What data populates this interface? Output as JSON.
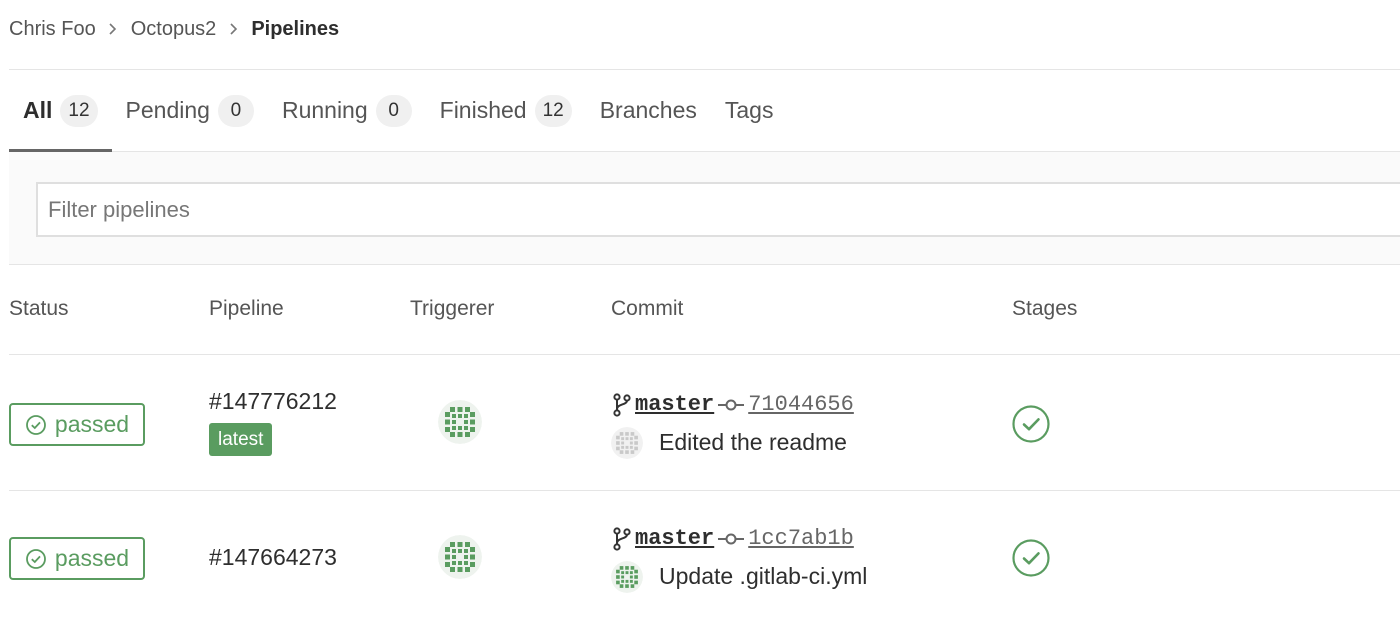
{
  "breadcrumb": {
    "items": [
      "Chris Foo",
      "Octopus2"
    ],
    "current": "Pipelines"
  },
  "tabs": [
    {
      "label": "All",
      "count": "12"
    },
    {
      "label": "Pending",
      "count": "0"
    },
    {
      "label": "Running",
      "count": "0"
    },
    {
      "label": "Finished",
      "count": "12"
    },
    {
      "label": "Branches"
    },
    {
      "label": "Tags"
    }
  ],
  "filter": {
    "placeholder": "Filter pipelines",
    "value": ""
  },
  "columns": [
    "Status",
    "Pipeline",
    "Triggerer",
    "Commit",
    "Stages"
  ],
  "rows": [
    {
      "status": "passed",
      "pipeline_id": "#147776212",
      "tag": "latest",
      "branch": "master",
      "sha": "71044656",
      "commit_title": "Edited the readme"
    },
    {
      "status": "passed",
      "pipeline_id": "#147664273",
      "branch": "master",
      "sha": "1cc7ab1b",
      "commit_title": "Update .gitlab-ci.yml"
    }
  ],
  "colors": {
    "success": "#5a9c60",
    "active_tab_underline": "#666666"
  },
  "icons": {
    "breadcrumb_separator": "chevron-right-icon",
    "status": "check-circle-icon",
    "branch": "git-branch-icon",
    "commit": "git-commit-icon",
    "stage": "stage-success-icon",
    "avatar": "identicon-avatar"
  }
}
